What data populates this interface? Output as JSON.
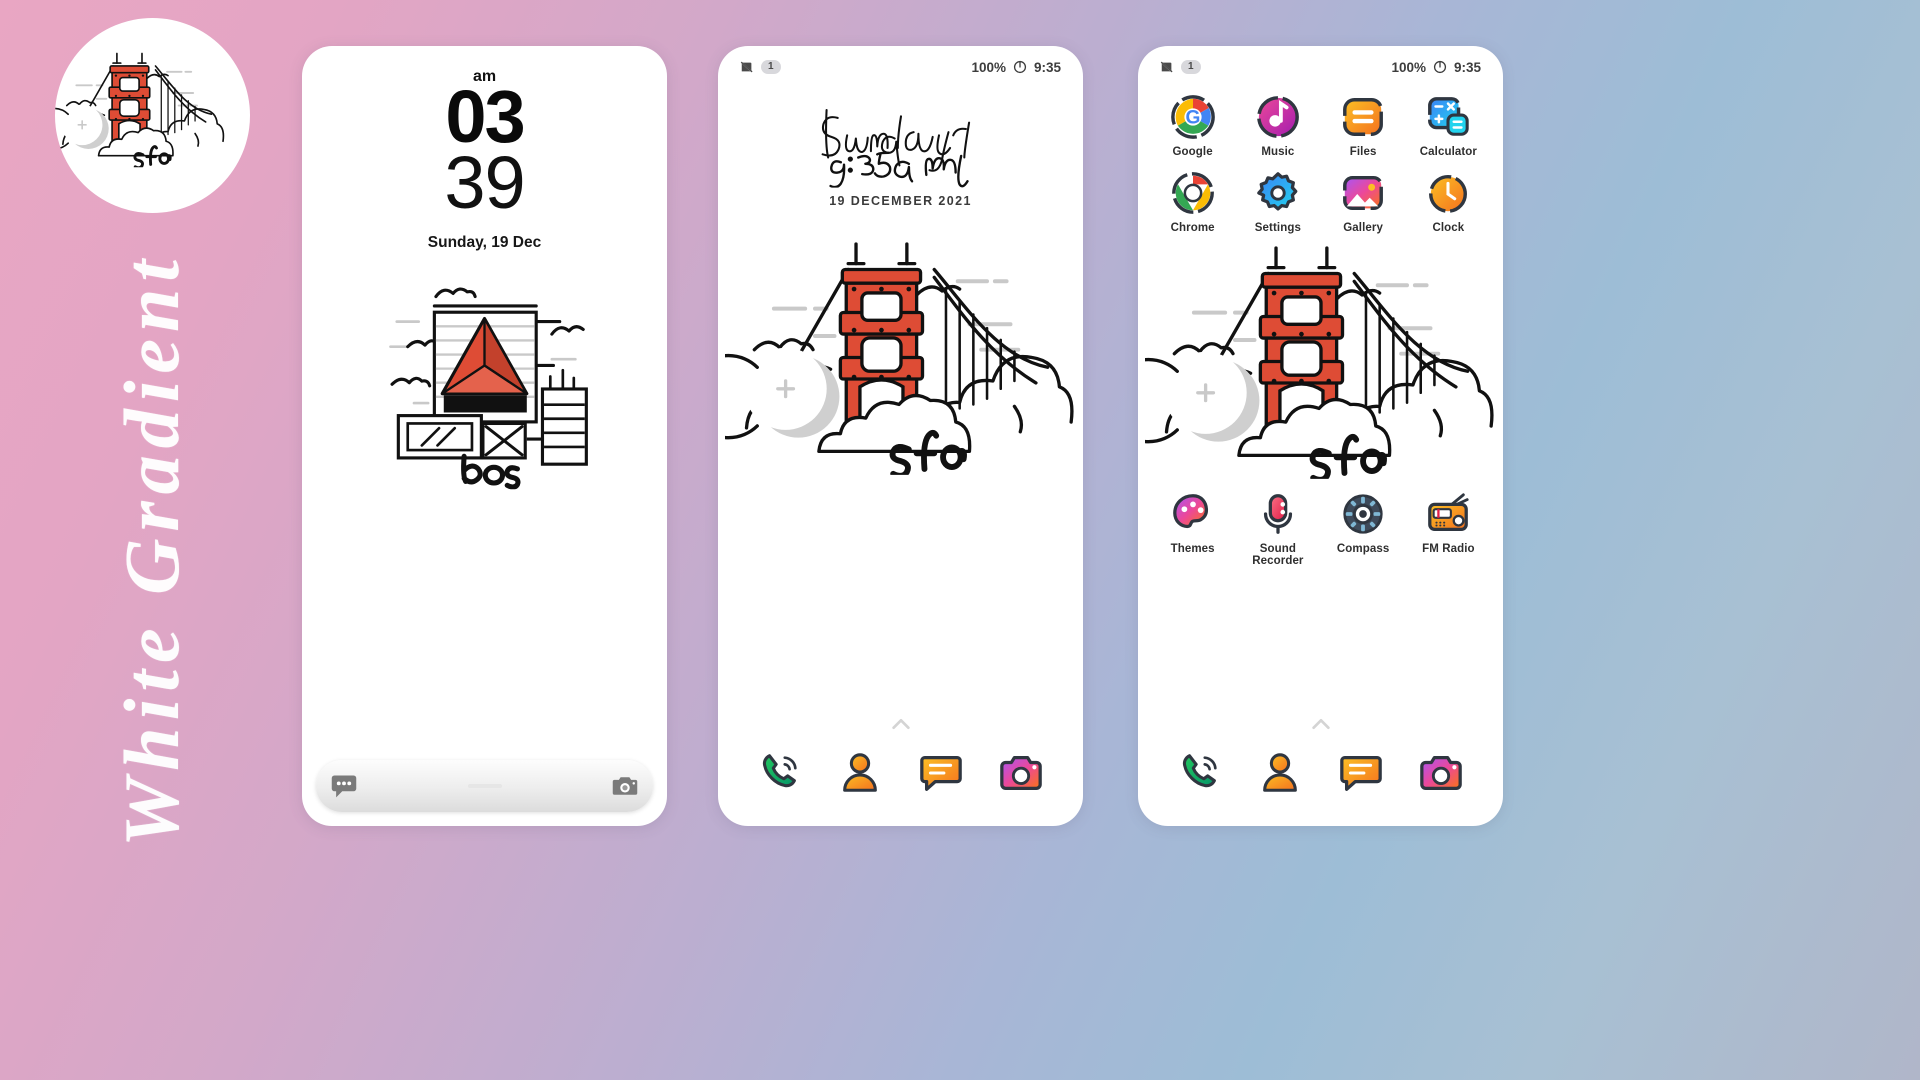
{
  "brand": {
    "title": "White Gradient",
    "logo_icon": "golden-gate-bridge-sfo-logo"
  },
  "background": {
    "gradient_from": "#e9a6c3",
    "gradient_mid": "#b3b0d2",
    "gradient_to": "#a8c0d3"
  },
  "status_bar": {
    "mute_icon": "silent-mode-icon",
    "notification_count": "1",
    "battery_percent": "100%",
    "battery_icon": "battery-icon",
    "time": "9:35"
  },
  "phone1": {
    "name": "lock-screen",
    "clock": {
      "meridiem": "am",
      "hours": "03",
      "minutes": "39",
      "date": "Sunday, 19 Dec"
    },
    "wallpaper": {
      "illustration": "boston-skyline-illustration",
      "caption": "bos",
      "accent": "#de4c35"
    },
    "bottom_bar": {
      "left_icon": "messages-bubble-icon",
      "right_icon": "camera-icon",
      "handle": "home-handle"
    }
  },
  "phone2": {
    "name": "home-screen-wallpaper",
    "clock": {
      "script_day": "Sunday",
      "script_time": "9:35am",
      "date": "19 DECEMBER 2021"
    },
    "wallpaper": {
      "illustration": "golden-gate-bridge-illustration",
      "caption": "sfo",
      "accent": "#de4c35"
    },
    "page_indicator": "chevron-up-icon",
    "dock": [
      {
        "label": "Phone",
        "icon": "phone-icon",
        "color": "#16c172"
      },
      {
        "label": "Contacts",
        "icon": "contacts-icon",
        "color": "#f9a825"
      },
      {
        "label": "Messages",
        "icon": "messages-icon",
        "color": "#f5a623"
      },
      {
        "label": "Camera",
        "icon": "camera-icon",
        "color": "#e1306c"
      }
    ]
  },
  "phone3": {
    "name": "home-screen-apps",
    "apps_top": [
      {
        "label": "Google",
        "icon": "google-icon"
      },
      {
        "label": "Music",
        "icon": "music-icon"
      },
      {
        "label": "Files",
        "icon": "files-icon"
      },
      {
        "label": "Calculator",
        "icon": "calculator-icon"
      },
      {
        "label": "Chrome",
        "icon": "chrome-icon"
      },
      {
        "label": "Settings",
        "icon": "settings-gear-icon"
      },
      {
        "label": "Gallery",
        "icon": "gallery-icon"
      },
      {
        "label": "Clock",
        "icon": "clock-icon"
      }
    ],
    "apps_bottom": [
      {
        "label": "Themes",
        "icon": "themes-palette-icon"
      },
      {
        "label": "Sound Recorder",
        "icon": "microphone-icon"
      },
      {
        "label": "Compass",
        "icon": "compass-icon"
      },
      {
        "label": "FM Radio",
        "icon": "radio-icon"
      }
    ],
    "wallpaper": {
      "illustration": "golden-gate-bridge-illustration",
      "caption": "sfo"
    },
    "page_indicator": "chevron-up-icon",
    "dock": [
      {
        "label": "Phone",
        "icon": "phone-icon"
      },
      {
        "label": "Contacts",
        "icon": "contacts-icon"
      },
      {
        "label": "Messages",
        "icon": "messages-icon"
      },
      {
        "label": "Camera",
        "icon": "camera-icon"
      }
    ]
  }
}
